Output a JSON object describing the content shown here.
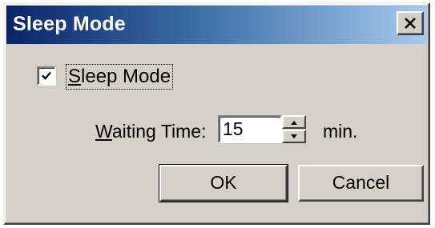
{
  "window": {
    "title": "Sleep Mode",
    "close_icon": "close-icon"
  },
  "checkbox": {
    "accesskey": "S",
    "label_rest": "leep Mode",
    "checked": true
  },
  "waiting": {
    "accesskey": "W",
    "label_rest": "aiting Time:",
    "value": "15",
    "unit": "min."
  },
  "buttons": {
    "ok_label": "OK",
    "cancel_label": "Cancel"
  },
  "colors": {
    "face": "#d4d0c8",
    "title_start": "#0a246a",
    "title_end": "#a6caf0"
  }
}
